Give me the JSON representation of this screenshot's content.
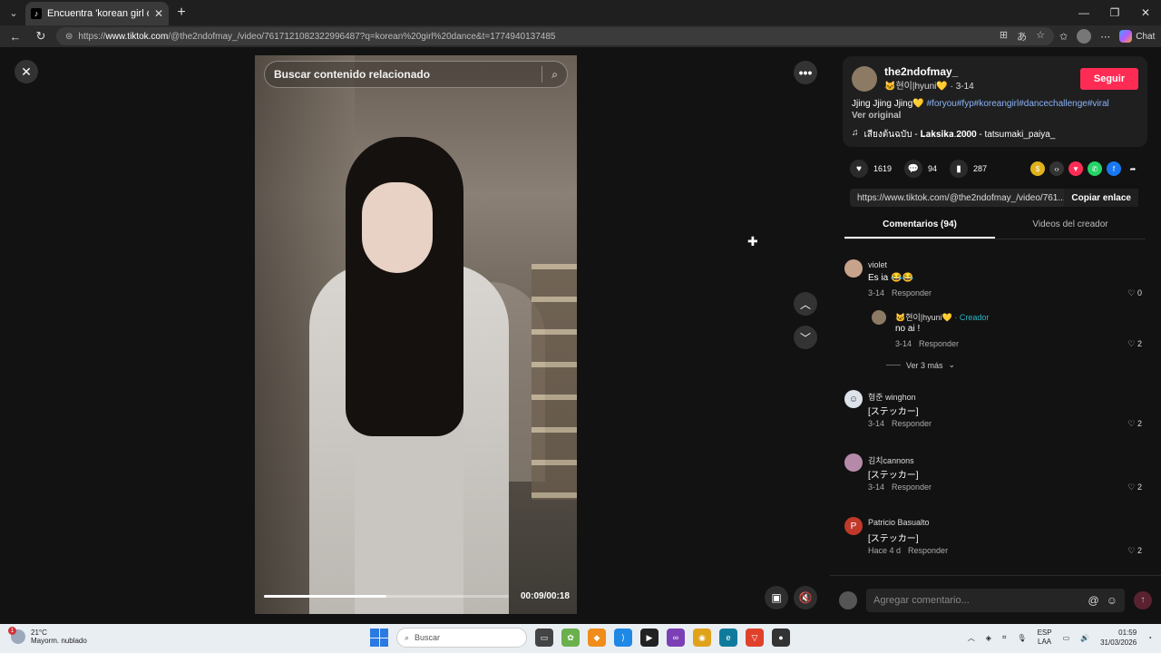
{
  "browser": {
    "tab_title": "Encuentra 'korean girl dance' en T",
    "url_prefix": "https://",
    "url_host": "www.tiktok.com",
    "url_path": "/@the2ndofmay_/video/7617121082322996487?q=korean%20girl%20dance&t=1774940137485",
    "chat_label": "Chat"
  },
  "video": {
    "search_placeholder": "Buscar contenido relacionado",
    "time": "00:09/00:18",
    "progress": 0.5
  },
  "post": {
    "username": "the2ndofmay_",
    "nickname_date": "🐱현이|hyuni💛 · 3-14",
    "follow_label": "Seguir",
    "desc_text": "Jjing Jjing Jjing💛 ",
    "desc_tags": "#foryou#fyp#koreangirl#dancechallenge#viral",
    "see_original": "Ver original",
    "music_icon": "♫",
    "music": "เสียงต้นฉบับ - 𝐋𝐚𝐤𝐬𝐢𝐤𝐚.𝟐𝟎𝟎𝟎 - tatsumaki_paiya_",
    "likes": "1619",
    "comments": "94",
    "saves": "287",
    "link": "https://www.tiktok.com/@the2ndofmay_/video/761...",
    "copy_label": "Copiar enlace"
  },
  "tabs": {
    "comments": "Comentarios (94)",
    "creator_videos": "Videos del creador"
  },
  "comments": [
    {
      "name": "violet",
      "text": "Es ia 😂😂",
      "date": "3-14",
      "reply": "Responder",
      "likes": "0"
    },
    {
      "name": "🐱현이|hyuni💛",
      "creator": "· Creador",
      "text": "no ai !",
      "date": "3-14",
      "reply": "Responder",
      "likes": "2"
    },
    {
      "name": "형준 winghon",
      "text": "[ステッカー]",
      "date": "3-14",
      "reply": "Responder",
      "likes": "2"
    },
    {
      "name": "김치cannons",
      "text": "[ステッカー]",
      "date": "3-14",
      "reply": "Responder",
      "likes": "2"
    },
    {
      "name": "Patricio Basualto",
      "avatar_letter": "P",
      "text": "[ステッカー]",
      "date": "Hace 4 d",
      "reply": "Responder",
      "likes": "2"
    }
  ],
  "view_more": "Ver 3 más",
  "add_comment_placeholder": "Agregar comentario...",
  "taskbar": {
    "weather_temp": "21°C",
    "weather_desc": "Mayorm. nublado",
    "weather_badge": "1",
    "search": "Buscar",
    "lang1": "ESP",
    "lang2": "LAA",
    "time": "01:59",
    "date": "31/03/2026"
  }
}
